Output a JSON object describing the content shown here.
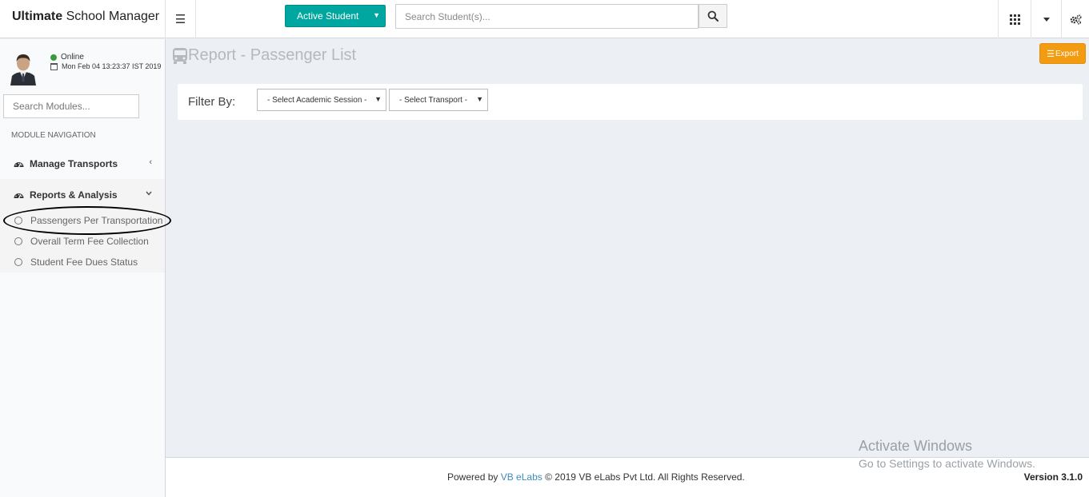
{
  "header": {
    "app_title_bold": "Ultimate",
    "app_title_rest": "School Manager",
    "active_student_label": "Active Student",
    "search_placeholder": "Search Student(s)..."
  },
  "user": {
    "status": "Online",
    "datetime": "Mon Feb 04 13:23:37 IST 2019"
  },
  "sidebar": {
    "search_placeholder": "Search Modules...",
    "section_header": "MODULE NAVIGATION",
    "items": [
      {
        "label": "Manage Transports"
      },
      {
        "label": "Reports & Analysis"
      }
    ],
    "subitems": [
      {
        "label": "Passengers Per Transportation"
      },
      {
        "label": "Overall Term Fee Collection"
      },
      {
        "label": "Student Fee Dues Status"
      }
    ]
  },
  "main": {
    "page_title": "Report - Passenger List",
    "export_label": "Export",
    "filter_label": "Filter By:",
    "session_select": "- Select Academic Session -",
    "transport_select": "- Select Transport -"
  },
  "footer": {
    "powered_by": "Powered by",
    "company_link": "VB eLabs",
    "copyright": "© 2019 VB eLabs Pvt Ltd. All Rights Reserved.",
    "version": "Version 3.1.0"
  },
  "watermark": {
    "line1": "Activate Windows",
    "line2": "Go to Settings to activate Windows."
  },
  "colors": {
    "accent_teal": "#00a7a0",
    "export_orange": "#f39c12",
    "link_blue": "#3c8dbc"
  }
}
